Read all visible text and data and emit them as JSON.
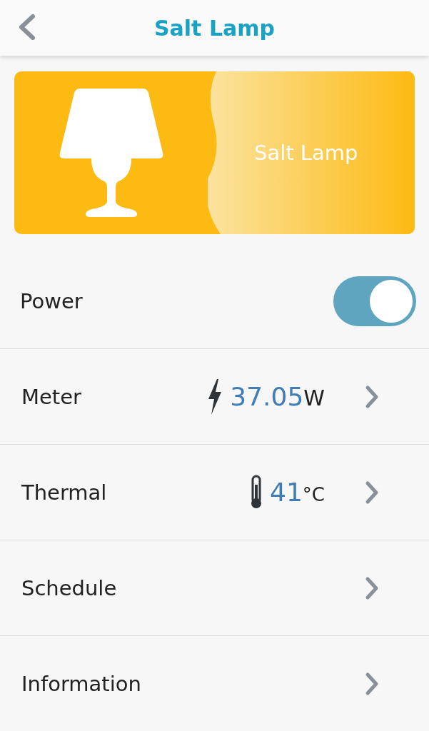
{
  "header": {
    "title": "Salt Lamp"
  },
  "device_card": {
    "name": "Salt Lamp"
  },
  "rows": [
    {
      "kind": "toggle",
      "label": "Power",
      "on": true
    },
    {
      "kind": "power_reading",
      "label": "Meter",
      "value": "37.05",
      "unit": "W"
    },
    {
      "kind": "temperature_reading",
      "label": "Thermal",
      "value": "41",
      "unit": "°C"
    },
    {
      "kind": "link",
      "label": "Schedule"
    },
    {
      "kind": "link",
      "label": "Information"
    }
  ]
}
